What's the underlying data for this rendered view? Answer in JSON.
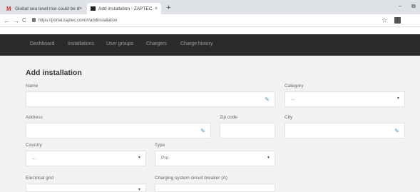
{
  "browser": {
    "tabs": [
      {
        "title": "Global sea level rise could be do...",
        "close": "×"
      },
      {
        "title": "Add installation - ZAPTEC",
        "close": "×"
      }
    ],
    "new_tab": "+",
    "minimize": "–",
    "maximize": "⧉",
    "back": "←",
    "forward": "→",
    "reload": "C",
    "url": "https://portal.zaptec.com/#/addinstallation",
    "star": "☆"
  },
  "nav": {
    "items": [
      "Dashboard",
      "Installations",
      "User groups",
      "Chargers",
      "Charge history"
    ]
  },
  "form": {
    "title": "Add installation",
    "name_label": "Name",
    "name_value": "",
    "category_label": "Category",
    "category_value": "...",
    "address_label": "Address",
    "address_value": "",
    "zip_label": "Zip code",
    "zip_value": "",
    "city_label": "City",
    "city_value": "",
    "country_label": "Country",
    "country_value": "...",
    "type_label": "Type",
    "type_value": "Pro",
    "grid_label": "Electrical grid",
    "grid_value": "",
    "breaker_label": "Charging system circuit breaker (A)",
    "breaker_value": ""
  }
}
